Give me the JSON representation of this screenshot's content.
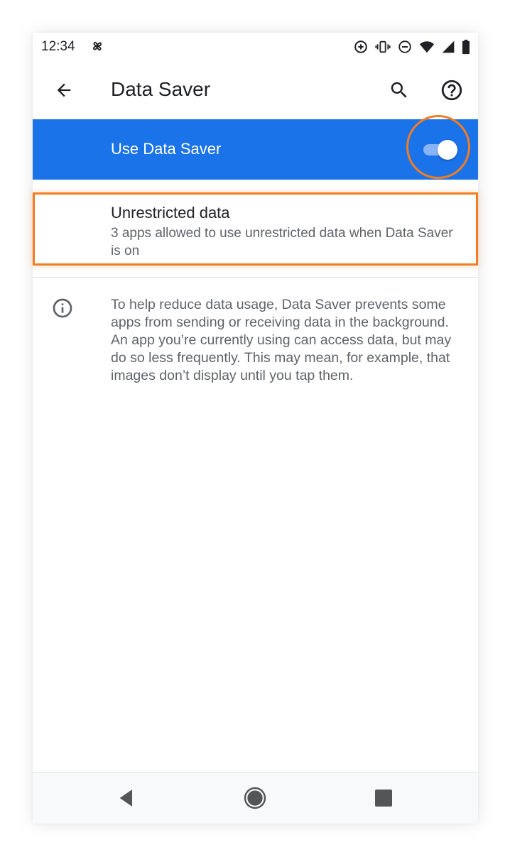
{
  "status_bar": {
    "time": "12:34",
    "icons": [
      "pinwheel-icon",
      "data-saver-icon",
      "vibrate-icon",
      "do-not-disturb-icon",
      "wifi-icon",
      "cell-signal-icon",
      "battery-icon"
    ]
  },
  "app_bar": {
    "title": "Data Saver",
    "icons": [
      "arrow-back-icon",
      "search-icon",
      "help-icon"
    ]
  },
  "master_switch": {
    "label": "Use Data Saver",
    "checked": true,
    "bar_color": "#1a73e8"
  },
  "unrestricted": {
    "title": "Unrestricted data",
    "summary": "3 apps allowed to use unrestricted data when Data Saver is on"
  },
  "footer": {
    "text": "To help reduce data usage, Data Saver prevents some apps from sending or receiving data in the background. An app you’re currently using can access data, but may do so less frequently. This may mean, for example, that images don’t display until you tap them."
  },
  "nav_bar": {
    "icons": [
      "nav-back-icon",
      "nav-home-icon",
      "nav-recents-icon"
    ]
  },
  "colors": {
    "highlight": "#f47c20",
    "accent": "#1a73e8"
  }
}
